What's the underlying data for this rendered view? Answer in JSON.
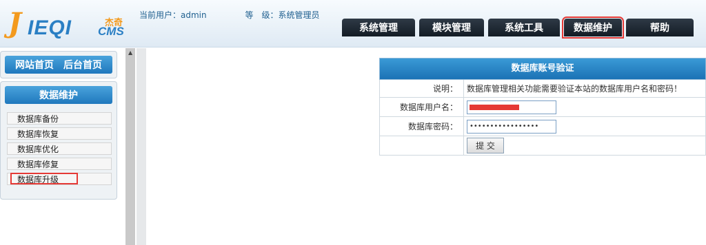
{
  "header": {
    "logo": {
      "main": "IEQI",
      "cn": "杰奇",
      "suffix": "CMS"
    },
    "current_user": "当前用户：admin",
    "level": "等　级：系统管理员"
  },
  "nav": {
    "items": [
      {
        "label": "系统管理"
      },
      {
        "label": "模块管理"
      },
      {
        "label": "系统工具"
      },
      {
        "label": "数据维护"
      },
      {
        "label": "帮助"
      }
    ]
  },
  "sidebar": {
    "top_links": [
      "网站首页",
      "后台首页"
    ],
    "section_title": "数据维护",
    "items": [
      "数据库备份",
      "数据库恢复",
      "数据库优化",
      "数据库修复",
      "数据库升级"
    ]
  },
  "form": {
    "title": "数据库账号验证",
    "note_label": "说明：",
    "note_text": "数据库管理相关功能需要验证本站的数据库用户名和密码！",
    "username_label": "数据库用户名：",
    "password_label": "数据库密码：",
    "password_mask": "•••••••••••••••••",
    "submit_label": "提 交"
  },
  "colors": {
    "accent_blue": "#1f78bd",
    "nav_dark": "#131c25",
    "highlight_red": "#e53935"
  }
}
